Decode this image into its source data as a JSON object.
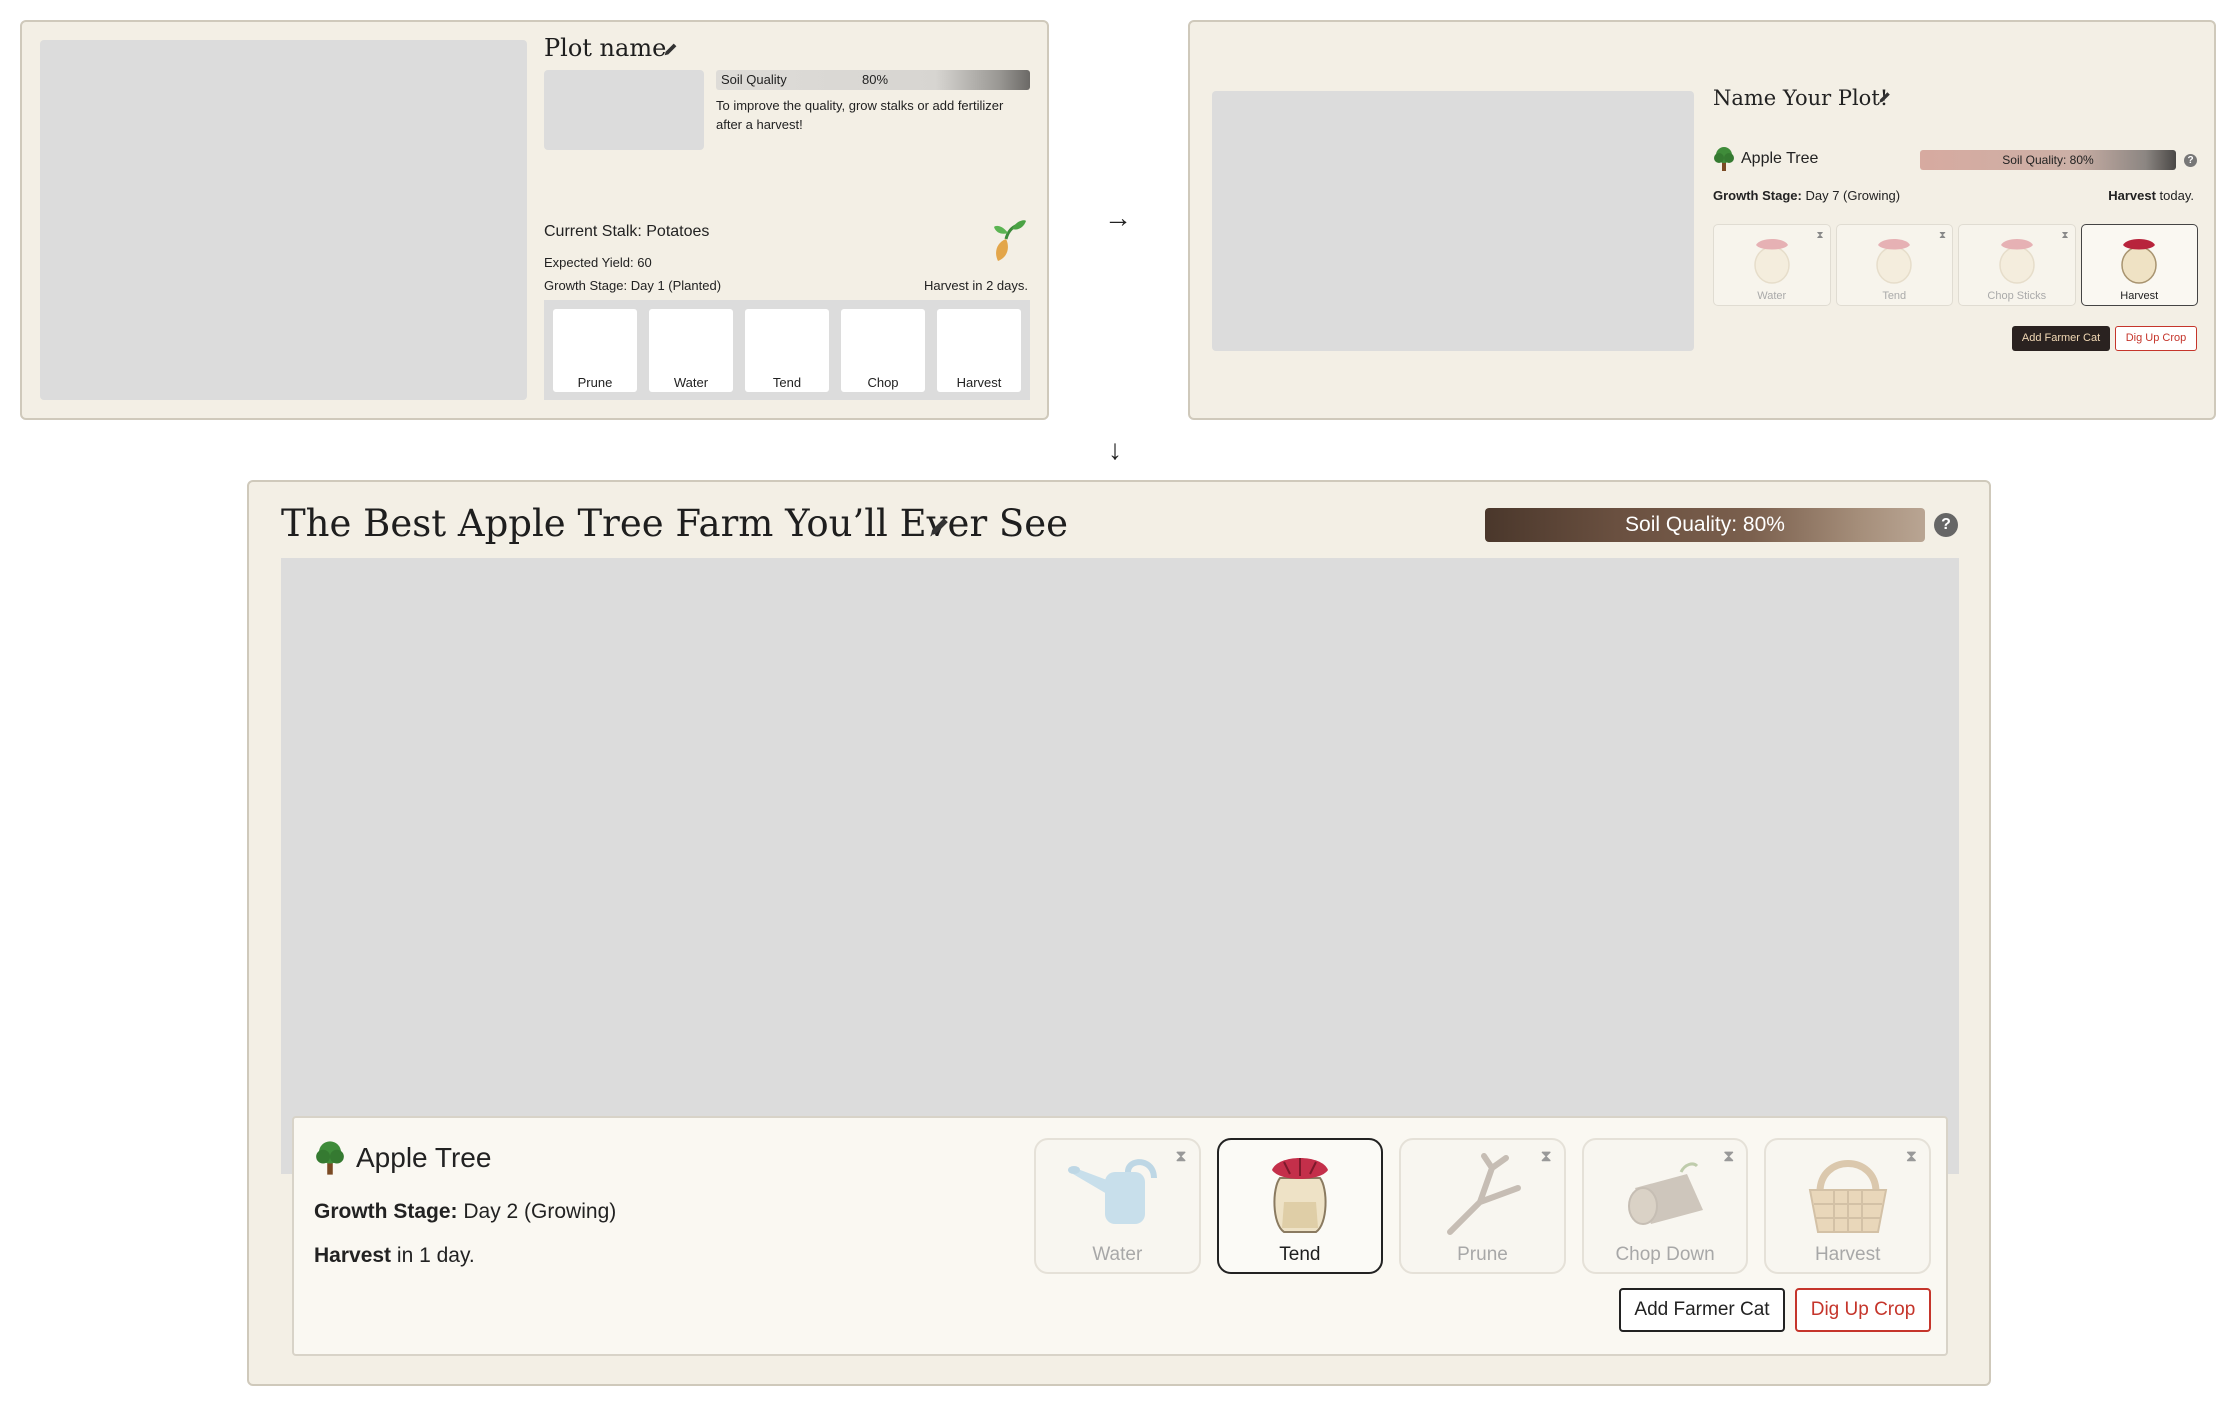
{
  "panel_a": {
    "title": "Plot name",
    "soil_label": "Soil Quality",
    "soil_value": "80%",
    "soil_fraction": 0.8,
    "soil_note": "To improve the quality, grow stalks or add fertilizer after a harvest!",
    "current_stalk": "Current Stalk: Potatoes",
    "expected_yield": "Expected Yield: 60",
    "growth_stage": "Growth Stage: Day 1 (Planted)",
    "harvest": "Harvest in 2 days.",
    "actions": [
      "Prune",
      "Water",
      "Tend",
      "Chop",
      "Harvest"
    ]
  },
  "arrows": {
    "right": "→",
    "down": "↓"
  },
  "panel_b": {
    "title": "Name Your Plot!",
    "crop_name": "Apple Tree",
    "soil_text": "Soil Quality: 80%",
    "help": "?",
    "growth_stage_label": "Growth Stage:",
    "growth_stage_value": "Day 7 (Growing)",
    "harvest_label": "Harvest",
    "harvest_value": "today.",
    "actions": [
      "Water",
      "Tend",
      "Chop Sticks",
      "Harvest"
    ],
    "add_cat": "Add Farmer Cat",
    "dig_up": "Dig Up Crop"
  },
  "panel_c": {
    "title": "The Best Apple Tree Farm You’ll Ever See",
    "soil_text": "Soil Quality: 80%",
    "help": "?",
    "crop_name": "Apple Tree",
    "growth_stage_label": "Growth Stage:",
    "growth_stage_value": "Day 2 (Growing)",
    "harvest_label": "Harvest",
    "harvest_value": "in 1 day.",
    "actions": [
      "Water",
      "Tend",
      "Prune",
      "Chop Down",
      "Harvest"
    ],
    "add_cat": "Add Farmer Cat",
    "dig_up": "Dig Up Crop"
  },
  "icons": {
    "edit": "pencil-icon",
    "tree": "tree-icon",
    "sprout": "sprout-icon",
    "timer": "hourglass-icon",
    "help": "help-icon",
    "water": "watering-can-icon",
    "tend": "jar-icon",
    "prune": "branch-icon",
    "chop": "log-icon",
    "harvest": "basket-icon"
  }
}
